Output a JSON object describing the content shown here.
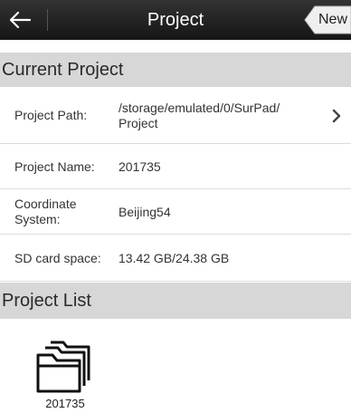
{
  "header": {
    "title": "Project",
    "new_label": "New"
  },
  "current_project": {
    "heading": "Current Project",
    "rows": [
      {
        "label": "Project Path:",
        "value": "/storage/emulated/0/SurPad/\nProject"
      },
      {
        "label": "Project Name:",
        "value": "201735"
      },
      {
        "label": "Coordinate\nSystem:",
        "value": "Beijing54"
      },
      {
        "label": "SD card space:",
        "value": "13.42 GB/24.38 GB"
      }
    ]
  },
  "project_list": {
    "heading": "Project List",
    "items": [
      {
        "name": "201735"
      }
    ]
  },
  "icons": [
    "back-arrow-icon",
    "chevron-right-icon",
    "folder-icon"
  ]
}
